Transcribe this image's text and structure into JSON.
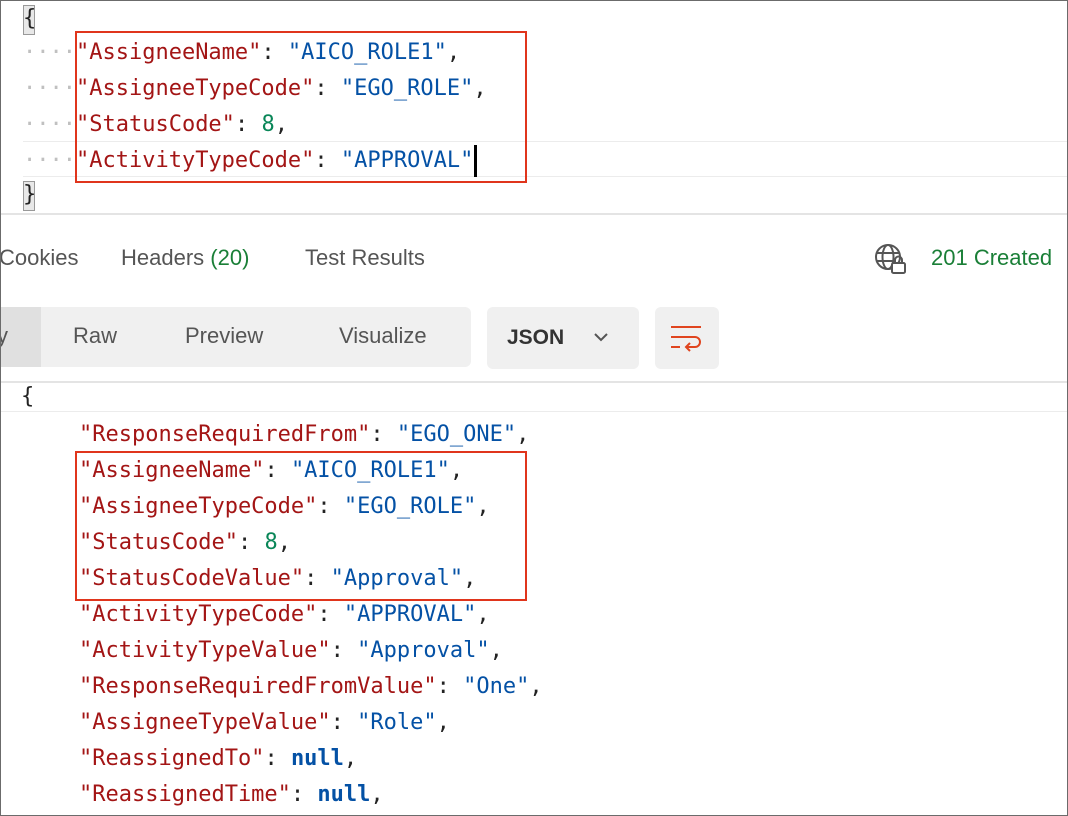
{
  "editor": {
    "open_brace": "{",
    "close_brace": "}",
    "indent": "····",
    "lines": [
      {
        "key": "\"AssigneeName\"",
        "sep": ": ",
        "value": "\"AICO_ROLE1\"",
        "tail": ","
      },
      {
        "key": "\"AssigneeTypeCode\"",
        "sep": ": ",
        "value": "\"EGO_ROLE\"",
        "tail": ","
      },
      {
        "key": "\"StatusCode\"",
        "sep": ": ",
        "value": "8",
        "tail": ","
      },
      {
        "key": "\"ActivityTypeCode\"",
        "sep": ": ",
        "value": "\"APPROVAL\"",
        "tail": ""
      }
    ]
  },
  "tabs": {
    "cookies": "Cookies",
    "headers": "Headers",
    "headers_count": "(20)",
    "test_results": "Test Results"
  },
  "status": {
    "text": "201 Created",
    "color": "#1a7f37"
  },
  "view_toggle": {
    "pretty_fragment": "y",
    "raw": "Raw",
    "preview": "Preview",
    "visualize": "Visualize"
  },
  "format_select": {
    "selected": "JSON"
  },
  "icons": {
    "globe": "globe-lock-icon",
    "chevron": "chevron-down-icon",
    "wrap": "wrap-lines-icon"
  },
  "response": {
    "open_brace": "{",
    "lines": [
      {
        "key": "\"ResponseRequiredFrom\"",
        "sep": ": ",
        "value": "\"EGO_ONE\"",
        "tail": ","
      },
      {
        "key": "\"AssigneeName\"",
        "sep": ": ",
        "value": "\"AICO_ROLE1\"",
        "tail": ","
      },
      {
        "key": "\"AssigneeTypeCode\"",
        "sep": ": ",
        "value": "\"EGO_ROLE\"",
        "tail": ","
      },
      {
        "key": "\"StatusCode\"",
        "sep": ": ",
        "value": "8",
        "tail": ","
      },
      {
        "key": "\"StatusCodeValue\"",
        "sep": ": ",
        "value": "\"Approval\"",
        "tail": ","
      },
      {
        "key": "\"ActivityTypeCode\"",
        "sep": ": ",
        "value": "\"APPROVAL\"",
        "tail": ","
      },
      {
        "key": "\"ActivityTypeValue\"",
        "sep": ": ",
        "value": "\"Approval\"",
        "tail": ","
      },
      {
        "key": "\"ResponseRequiredFromValue\"",
        "sep": ": ",
        "value": "\"One\"",
        "tail": ","
      },
      {
        "key": "\"AssigneeTypeValue\"",
        "sep": ": ",
        "value": "\"Role\"",
        "tail": ","
      },
      {
        "key": "\"ReassignedTo\"",
        "sep": ": ",
        "value": "null",
        "tail": ","
      },
      {
        "key": "\"ReassignedTime\"",
        "sep": ": ",
        "value": "null",
        "tail": ","
      }
    ]
  },
  "highlight_color": "#e0351c"
}
